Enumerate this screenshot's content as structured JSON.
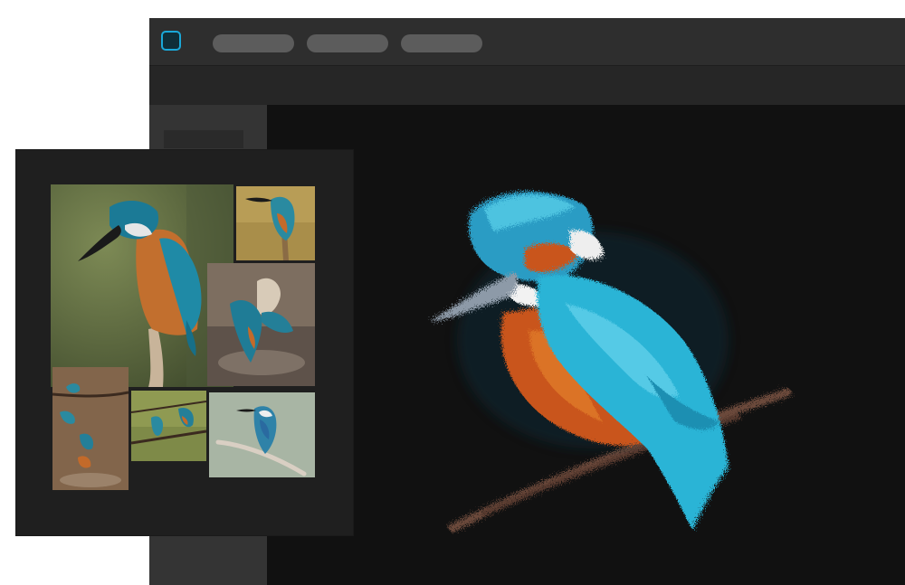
{
  "app": {
    "logo_icon": "app-logo-icon",
    "accent_color": "#1aa8d8",
    "menu": [
      {
        "name": "menu-pill-1",
        "label": ""
      },
      {
        "name": "menu-pill-2",
        "label": ""
      },
      {
        "name": "menu-pill-3",
        "label": ""
      }
    ]
  },
  "reference_board": {
    "photos": [
      {
        "name": "kingfisher-perched-photo"
      },
      {
        "name": "kingfisher-on-stick-photo"
      },
      {
        "name": "kingfisher-splash-photo"
      },
      {
        "name": "kingfisher-sequence-photo"
      },
      {
        "name": "kingfisher-pair-photo"
      },
      {
        "name": "kingfisher-branch-photo"
      }
    ]
  },
  "canvas": {
    "painting_subject": "kingfisher-painting",
    "colors": {
      "background": "#111111",
      "wing": "#2ab4d6",
      "breast": "#c9541a",
      "beak": "#8d9aa8",
      "branch": "#8a5c48"
    }
  }
}
